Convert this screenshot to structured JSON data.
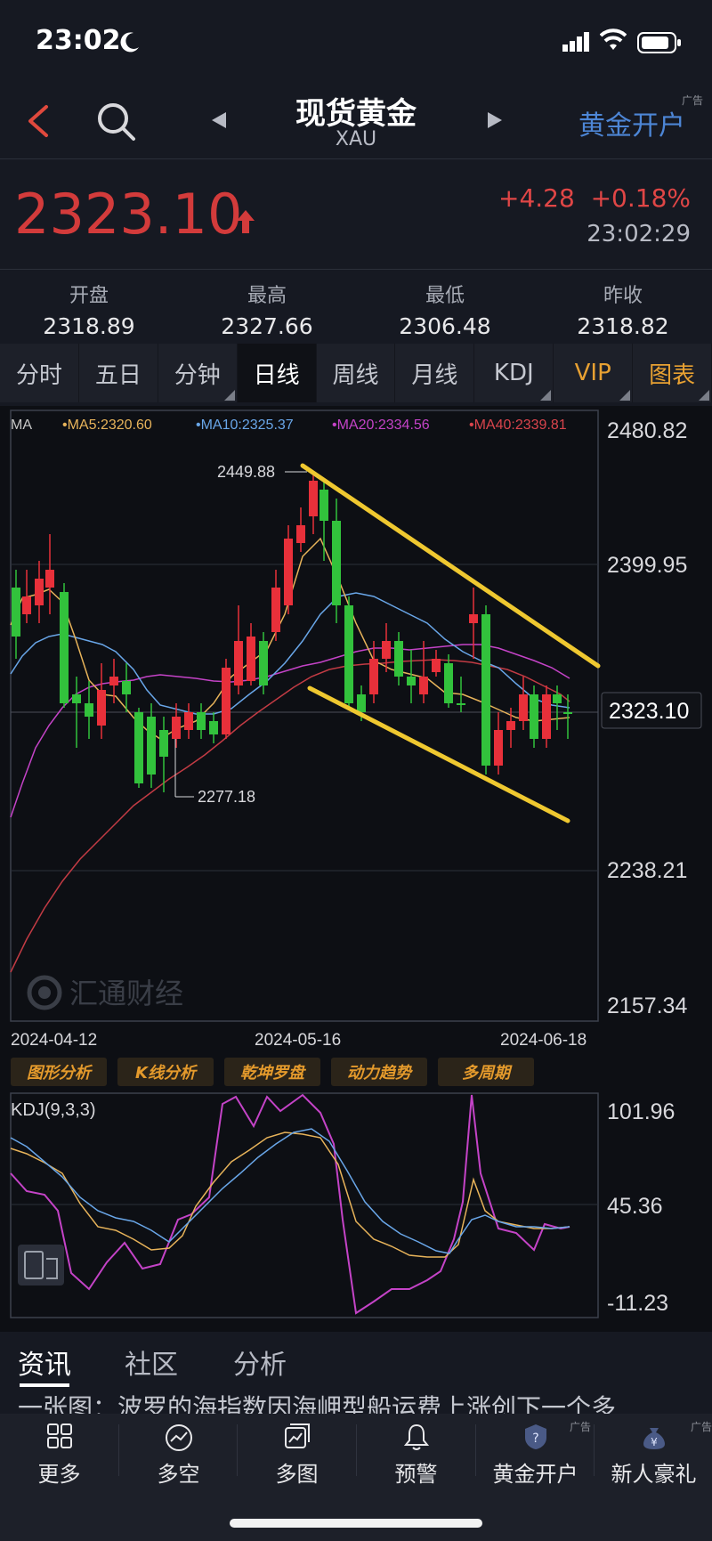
{
  "status_bar": {
    "time": "23:02"
  },
  "header": {
    "title": "现货黄金",
    "subtitle": "XAU",
    "open_account": "黄金开户",
    "ad_tag": "广告"
  },
  "quote": {
    "price": "2323.10",
    "change": "+4.28",
    "change_pct": "+0.18%",
    "time": "23:02:29"
  },
  "ohlc": [
    {
      "label": "开盘",
      "value": "2318.89"
    },
    {
      "label": "最高",
      "value": "2327.66"
    },
    {
      "label": "最低",
      "value": "2306.48"
    },
    {
      "label": "昨收",
      "value": "2318.82"
    }
  ],
  "period_tabs": [
    {
      "label": "分时"
    },
    {
      "label": "五日"
    },
    {
      "label": "分钟"
    },
    {
      "label": "日线"
    },
    {
      "label": "周线"
    },
    {
      "label": "月线"
    },
    {
      "label": "KDJ"
    },
    {
      "label": "VIP"
    },
    {
      "label": "图表"
    }
  ],
  "main_chart": {
    "ma_legend": [
      {
        "label": "MA",
        "color": "#c8c8c8"
      },
      {
        "label": "•MA5:2320.60",
        "color": "#e7b35a"
      },
      {
        "label": "•MA10:2325.37",
        "color": "#69a6e8"
      },
      {
        "label": "•MA20:2334.56",
        "color": "#c443c7"
      },
      {
        "label": "•MA40:2339.81",
        "color": "#d9444c"
      }
    ],
    "y_ticks": [
      "2480.82",
      "2399.95",
      "2323.10",
      "2238.21",
      "2157.34"
    ],
    "x_ticks": [
      "2024-04-12",
      "2024-05-16",
      "2024-06-18"
    ],
    "high_label": "2449.88",
    "low_label": "2277.18",
    "watermark": "汇通财经"
  },
  "tools": [
    "图形分析",
    "K线分析",
    "乾坤罗盘",
    "动力趋势",
    "多周期"
  ],
  "kdj_chart": {
    "label": "KDJ(9,3,3)",
    "y_ticks": [
      "101.96",
      "45.36",
      "-11.23"
    ]
  },
  "news_tabs": [
    {
      "label": "资讯"
    },
    {
      "label": "社区"
    },
    {
      "label": "分析"
    }
  ],
  "headline": "一张图：波罗的海指数因海岬型船运费上涨创下一个多",
  "bottom_nav": [
    {
      "label": "更多"
    },
    {
      "label": "多空"
    },
    {
      "label": "多图"
    },
    {
      "label": "预警"
    },
    {
      "label": "黄金开户"
    },
    {
      "label": "新人豪礼"
    }
  ],
  "colors": {
    "up": "#e8303a",
    "down": "#32c23c",
    "accent": "#4d86d6",
    "gold": "#e8a132"
  }
}
